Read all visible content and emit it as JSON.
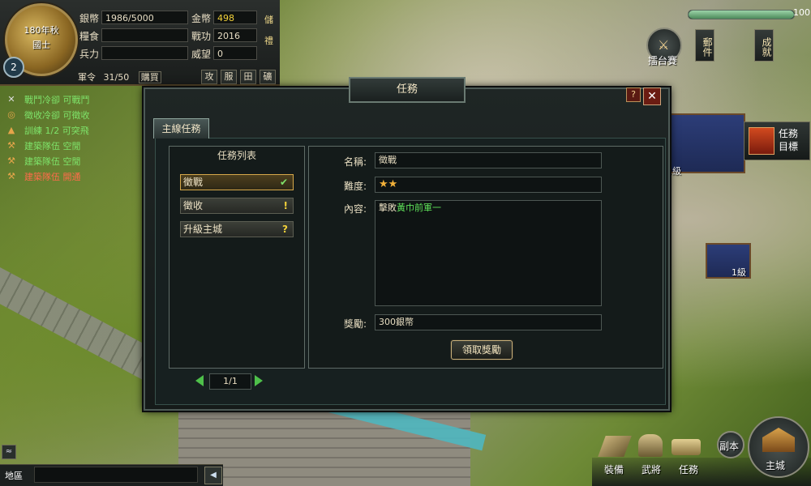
{
  "status": {
    "season": "180年秋",
    "city": "國士",
    "level": "2",
    "silver_label": "銀幣",
    "silver_value": "1986/5000",
    "gold_label": "金幣",
    "gold_value": "498",
    "food_label": "糧食",
    "food_value": "",
    "merit_label": "戰功",
    "merit_value": "2016",
    "troops_label": "兵力",
    "troops_value": "",
    "prestige_label": "威望",
    "prestige_value": "0",
    "recharge_label": "儲",
    "gift_label": "禮",
    "orders_label": "軍令",
    "orders_value": "31/50",
    "buy_label": "購買",
    "cmd_buttons": [
      "攻",
      "服",
      "田",
      "礦"
    ]
  },
  "queue": [
    {
      "icon": "✕",
      "text": "戰鬥冷卻 可戰鬥",
      "color": "green"
    },
    {
      "icon": "◎",
      "text": "徵收冷卻 可徵收",
      "color": "green"
    },
    {
      "icon": "▲",
      "text": "訓練 1/2 可突飛",
      "color": "green"
    },
    {
      "icon": "⚒",
      "text": "建築隊伍 空閒",
      "color": "green"
    },
    {
      "icon": "⚒",
      "text": "建築隊伍 空閒",
      "color": "green"
    },
    {
      "icon": "⚒",
      "text": "建築隊伍 開通",
      "color": "red"
    }
  ],
  "top_right": {
    "hp_value": "100",
    "hp_fraction": 1.0,
    "arena_label": "擂台賽",
    "mail_label": "郵件",
    "achievement_label": "成就",
    "task_goal_label": "任務目標"
  },
  "map": {
    "building_level_1": "2級",
    "building_level_2": "1級"
  },
  "dialog": {
    "title": "任務",
    "help": "?",
    "tab_main": "主線任務",
    "list_title": "任務列表",
    "tasks": [
      {
        "name": "徵戰",
        "mark": "✔",
        "mark_color": "#7fe26a"
      },
      {
        "name": "徵收",
        "mark": "!",
        "mark_color": "#f3d23a"
      },
      {
        "name": "升級主城",
        "mark": "?",
        "mark_color": "#f3d23a"
      }
    ],
    "name_label": "名稱:",
    "name_value": "徵戰",
    "difficulty_label": "難度:",
    "difficulty_stars": "★★",
    "content_label": "內容:",
    "content_prefix": "擊敗",
    "content_highlight": "黃巾前軍一",
    "reward_label": "獎勵:",
    "reward_value": "300銀幣",
    "claim_button": "領取獎勵",
    "page": "1/1"
  },
  "bottom": {
    "chat_label": "地區",
    "send_icon": "◀",
    "expand_icon": "≈",
    "instance_label": "副本",
    "equip_label": "裝備",
    "general_label": "武將",
    "task_label": "任務",
    "maincity_label": "主城"
  }
}
